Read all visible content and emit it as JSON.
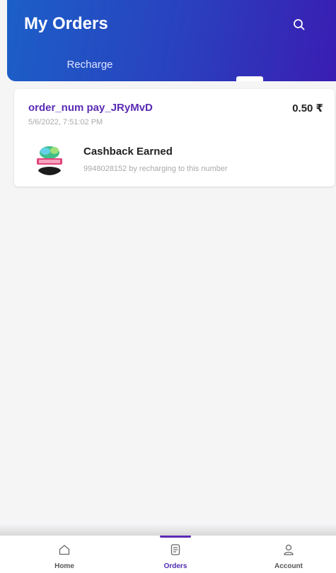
{
  "header": {
    "title": "My Orders",
    "search_icon": "search-icon"
  },
  "tabs": [
    {
      "label": "Recharge",
      "active": true
    }
  ],
  "orders": [
    {
      "order_id": "order_num pay_JRyMvD",
      "amount": "0.50 ₹",
      "date": "5/6/2022, 7:51:02 PM",
      "item_title": "Cashback Earned",
      "item_description": "9948028152 by recharging to this number"
    }
  ],
  "bottom_nav": {
    "items": [
      {
        "label": "Home",
        "icon": "home-icon",
        "active": false
      },
      {
        "label": "Orders",
        "icon": "orders-icon",
        "active": true
      },
      {
        "label": "Account",
        "icon": "account-icon",
        "active": false
      }
    ]
  },
  "colors": {
    "header_gradient_start": "#1c5fc8",
    "header_gradient_end": "#3a1db3",
    "accent": "#5b2bb5",
    "background": "#f5f5f6"
  }
}
